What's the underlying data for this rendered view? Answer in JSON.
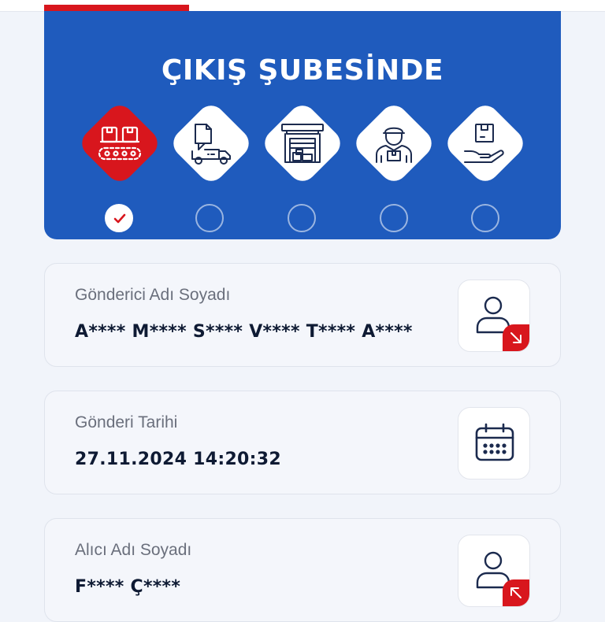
{
  "status": {
    "title": "ÇIKIŞ ŞUBESİNDE",
    "steps": [
      {
        "icon": "conveyor-boxes-icon",
        "active": true,
        "done": true
      },
      {
        "icon": "delivery-truck-icon",
        "active": false,
        "done": false
      },
      {
        "icon": "warehouse-icon",
        "active": false,
        "done": false
      },
      {
        "icon": "courier-icon",
        "active": false,
        "done": false
      },
      {
        "icon": "hand-package-icon",
        "active": false,
        "done": false
      }
    ]
  },
  "sender": {
    "label": "Gönderici Adı Soyadı",
    "value": "A**** M**** S**** V**** T**** A****",
    "icon": "user-outgoing-icon"
  },
  "shipment_date": {
    "label": "Gönderi Tarihi",
    "value": "27.11.2024 14:20:32",
    "icon": "calendar-icon"
  },
  "receiver": {
    "label": "Alıcı Adı Soyadı",
    "value": "F**** Ç****",
    "icon": "user-incoming-icon"
  },
  "colors": {
    "brand_blue": "#1f5bbd",
    "accent_red": "#d8161d",
    "icon_navy": "#1b2a4e"
  }
}
